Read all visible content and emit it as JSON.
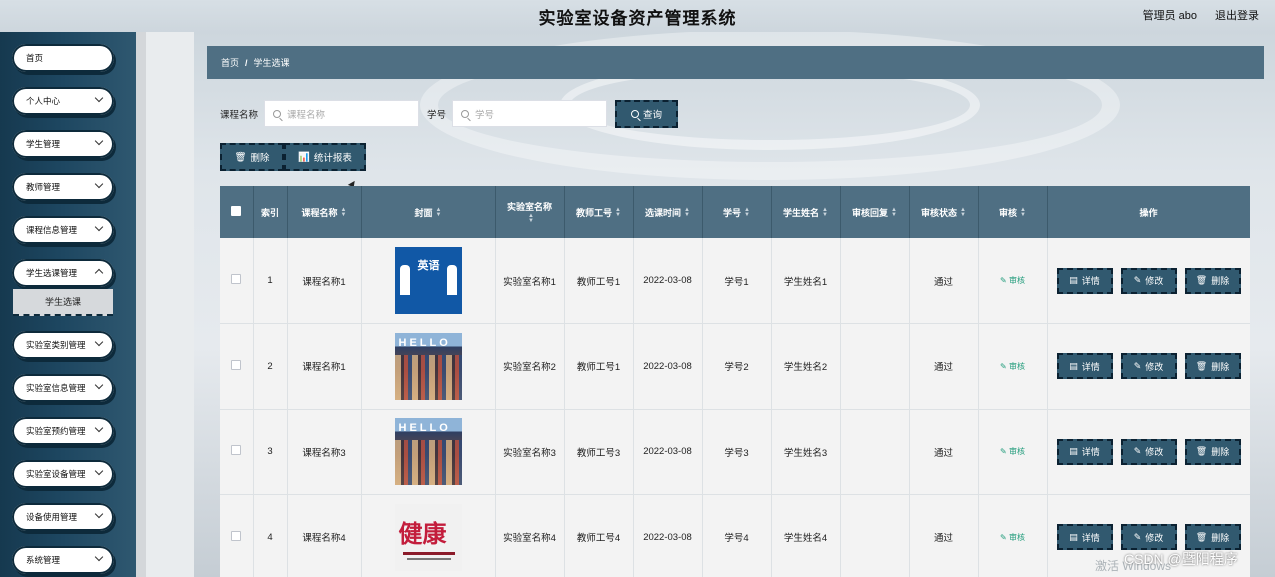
{
  "app": {
    "title": "实验室设备资产管理系统"
  },
  "header": {
    "user_label": "管理员 abo",
    "logout_label": "退出登录"
  },
  "sidebar": {
    "items": [
      {
        "label": "首页",
        "has_chevron": false
      },
      {
        "label": "个人中心",
        "has_chevron": true
      },
      {
        "label": "学生管理",
        "has_chevron": true
      },
      {
        "label": "教师管理",
        "has_chevron": true
      },
      {
        "label": "课程信息管理",
        "has_chevron": true
      },
      {
        "label": "学生选课管理",
        "has_chevron": true
      },
      {
        "label": "实验室类别管理",
        "has_chevron": true
      },
      {
        "label": "实验室信息管理",
        "has_chevron": true
      },
      {
        "label": "实验室预约管理",
        "has_chevron": true
      },
      {
        "label": "实验室设备管理",
        "has_chevron": true
      },
      {
        "label": "设备使用管理",
        "has_chevron": true
      },
      {
        "label": "系统管理",
        "has_chevron": true
      }
    ],
    "active_sub": "学生选课"
  },
  "breadcrumb": {
    "home": "首页",
    "separator": "/",
    "current": "学生选课"
  },
  "search": {
    "course_label": "课程名称",
    "course_placeholder": "课程名称",
    "student_label": "学号",
    "student_placeholder": "学号",
    "query_label": "查询"
  },
  "actions": {
    "delete_label": "删除",
    "stats_label": "统计报表"
  },
  "table": {
    "headers": {
      "index": "索引",
      "course": "课程名称",
      "cover": "封面",
      "lab": "实验室名称",
      "teacher": "教师工号",
      "time": "选课时间",
      "student_no": "学号",
      "student_name": "学生姓名",
      "reply": "审核回复",
      "status": "审核状态",
      "audit": "审核",
      "ops": "操作"
    },
    "rows": [
      {
        "index": "1",
        "course": "课程名称1",
        "lab": "实验室名称1",
        "teacher": "教师工号1",
        "time": "2022-03-08",
        "student_no": "学号1",
        "student_name": "学生姓名1",
        "reply": "",
        "status": "通过",
        "audit": "审核",
        "cover": "英语"
      },
      {
        "index": "2",
        "course": "课程名称1",
        "lab": "实验室名称2",
        "teacher": "教师工号1",
        "time": "2022-03-08",
        "student_no": "学号2",
        "student_name": "学生姓名2",
        "reply": "",
        "status": "通过",
        "audit": "审核",
        "cover": "HELLO"
      },
      {
        "index": "3",
        "course": "课程名称3",
        "lab": "实验室名称3",
        "teacher": "教师工号3",
        "time": "2022-03-08",
        "student_no": "学号3",
        "student_name": "学生姓名3",
        "reply": "",
        "status": "通过",
        "audit": "审核",
        "cover": "HELLO"
      },
      {
        "index": "4",
        "course": "课程名称4",
        "lab": "实验室名称4",
        "teacher": "教师工号4",
        "time": "2022-03-08",
        "student_no": "学号4",
        "student_name": "学生姓名4",
        "reply": "",
        "status": "通过",
        "audit": "审核",
        "cover": "健康"
      }
    ],
    "row_ops": {
      "detail": "详情",
      "edit": "修改",
      "delete": "删除"
    }
  },
  "overlay": {
    "windows_watermark": "激活 Windows",
    "csdn_watermark": "CSDN @暨阳程序"
  },
  "colors": {
    "primary": "#4f6f83",
    "button": "#31596f",
    "sidebar": "#1d4660",
    "audit": "#1f9b7a"
  }
}
